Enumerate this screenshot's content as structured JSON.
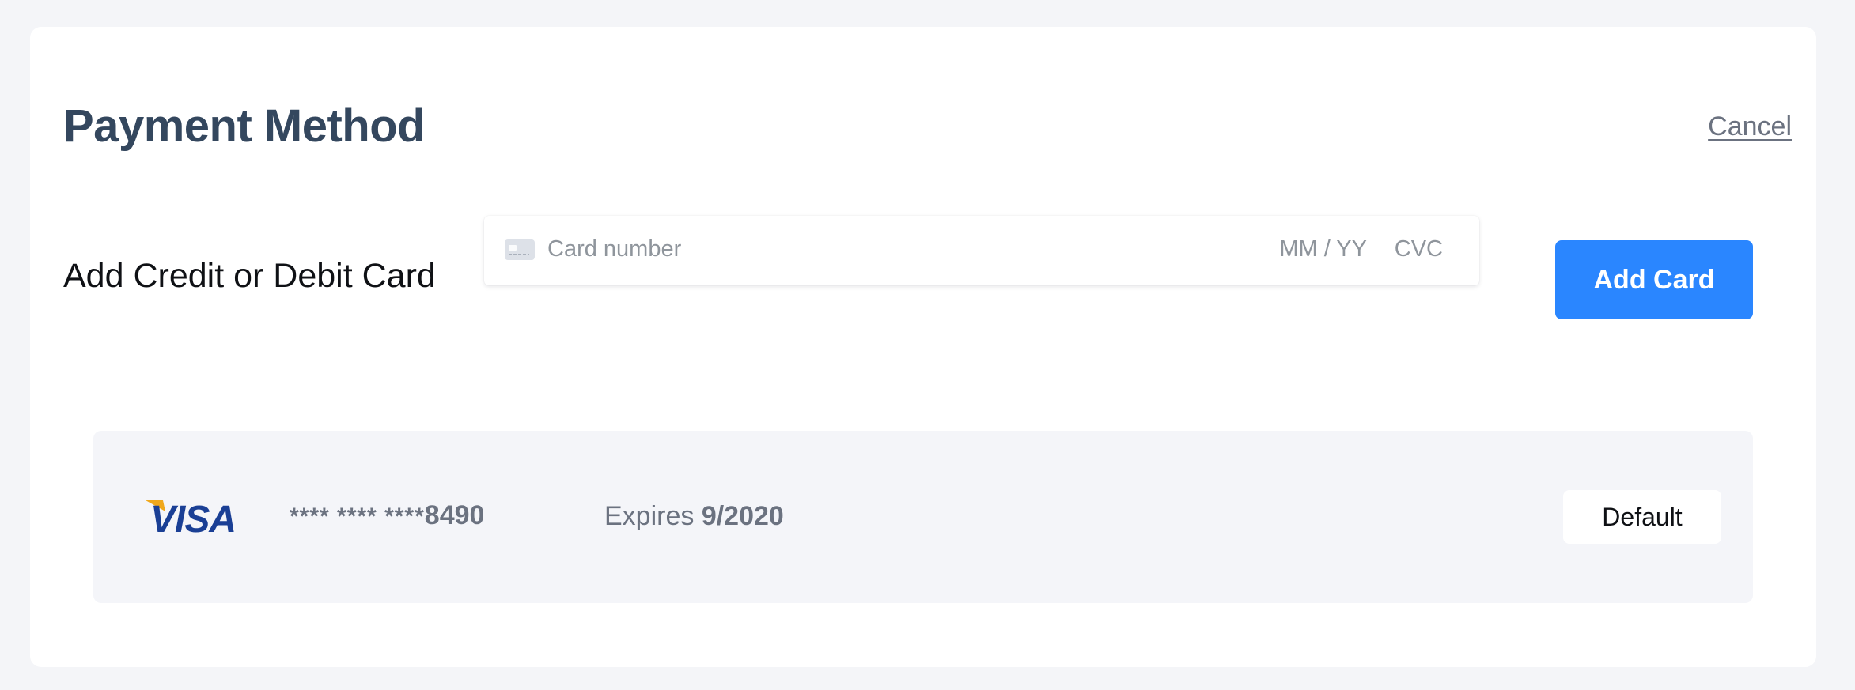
{
  "header": {
    "title": "Payment Method",
    "cancel_label": "Cancel"
  },
  "add_card": {
    "label": "Add Credit or Debit Card",
    "card_number_placeholder": "Card number",
    "expiry_placeholder": "MM / YY",
    "cvc_placeholder": "CVC",
    "card_icon": "credit-card-icon",
    "button_label": "Add Card",
    "button_color": "#2a86ff"
  },
  "saved_cards": [
    {
      "brand": "VISA",
      "brand_icon": "visa-logo",
      "masked_prefix": "**** **** ****",
      "last4": "8490",
      "expires_label": "Expires",
      "expires_value": "9/2020",
      "badge": "Default"
    }
  ],
  "colors": {
    "title": "#34475e",
    "accent": "#2a86ff",
    "visa_blue": "#1a3f95",
    "visa_gold": "#f0a81c"
  }
}
